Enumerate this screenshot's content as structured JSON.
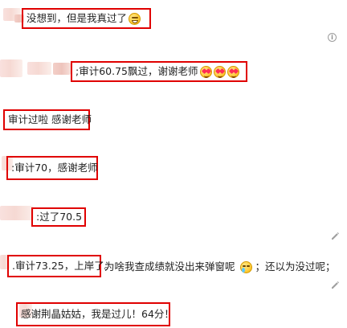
{
  "messages": [
    {
      "text": "没想到，但是我真过了",
      "emoji": "grin"
    },
    {
      "text": ";审计60.75飘过，谢谢老师",
      "emoji": [
        "heart-eyes",
        "heart-eyes",
        "heart-eyes"
      ]
    },
    {
      "text": "审计过啦 感谢老师"
    },
    {
      "text": ":审计70，感谢老师"
    },
    {
      "text": ":过了70.5"
    },
    {
      "text": ".审计73.25，上岸了。",
      "continuation": "为啥我查成绩就没出来弹窗呢",
      "after_emoji": "；还以为没过呢；",
      "emoji": "cry"
    },
    {
      "text": "感谢荆晶姑姑，我是过儿！64分！"
    }
  ],
  "icons": {
    "info": "info-icon",
    "edit": "edit-icon"
  }
}
